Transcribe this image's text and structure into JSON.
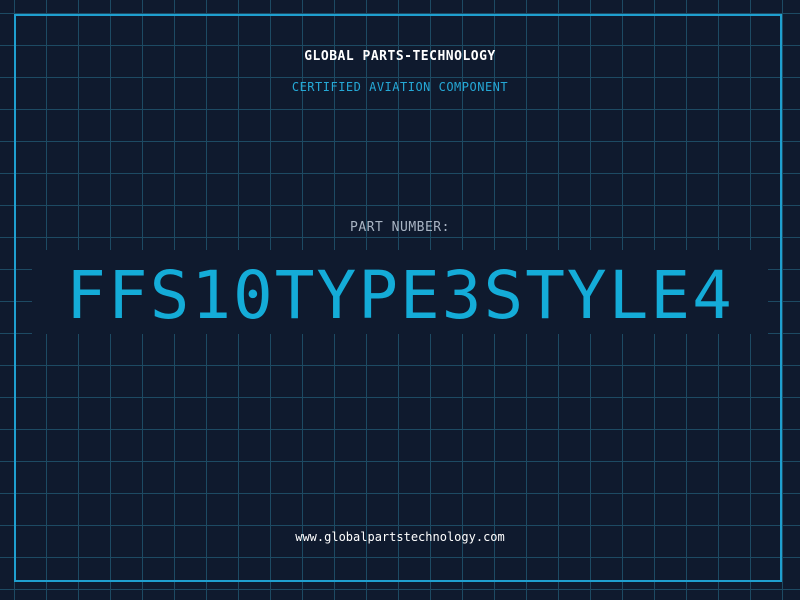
{
  "header": {
    "company": "GLOBAL PARTS-TECHNOLOGY",
    "subtitle": "CERTIFIED AVIATION COMPONENT"
  },
  "main": {
    "part_label": "PART NUMBER:",
    "part_number": "FFS10TYPE3STYLE4"
  },
  "footer": {
    "website": "www.globalpartstechnology.com"
  },
  "colors": {
    "background": "#0f1a2e",
    "grid": "#1d4a63",
    "accent": "#14acd8",
    "text": "#ffffff"
  }
}
